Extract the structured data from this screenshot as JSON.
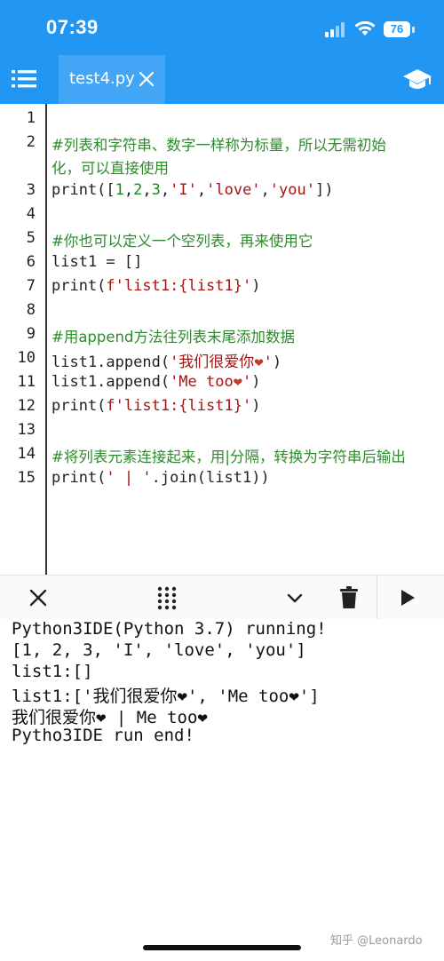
{
  "status_bar": {
    "time": "07:39",
    "battery": "76"
  },
  "tab": {
    "title": "test4.py"
  },
  "editor": {
    "line_numbers": [
      "1",
      "2",
      "3",
      "4",
      "5",
      "6",
      "7",
      "8",
      "9",
      "10",
      "11",
      "12",
      "13",
      "14",
      "15"
    ],
    "lines": {
      "l2a": "#列表和字符串、数字一样称为标量，所以无需初始",
      "l2b": "化，可以直接使用",
      "l3_print": "print([",
      "l3_1": "1",
      "l3_c1": ",",
      "l3_2": "2",
      "l3_c2": ",",
      "l3_3": "3",
      "l3_c3": ",",
      "l3_s1": "'I'",
      "l3_c4": ",",
      "l3_s2": "'love'",
      "l3_c5": ",",
      "l3_s3": "'you'",
      "l3_end": "])",
      "l5": "#你也可以定义一个空列表，再来使用它",
      "l6": "list1 = []",
      "l7_a": "print(",
      "l7_s": "f'list1:{list1}'",
      "l7_b": ")",
      "l9": "#用append方法往列表末尾添加数据",
      "l10_a": "list1.append(",
      "l10_s": "'我们很爱你",
      "l10_h": "❤",
      "l10_q": "'",
      "l10_b": ")",
      "l11_a": "list1.append(",
      "l11_s": "'Me too",
      "l11_h": "❤",
      "l11_q": "'",
      "l11_b": ")",
      "l12_a": "print(",
      "l12_s": "f'list1:{list1}'",
      "l12_b": ")",
      "l14": "#将列表元素连接起来，用|分隔，转换为字符串后输出",
      "l15_a": "print(",
      "l15_s": "' | '",
      "l15_b": ".join(list1))"
    }
  },
  "toolbar": {
    "close_icon": "close-icon",
    "keypad_icon": "keypad-icon",
    "chevron_icon": "chevron-down-icon",
    "delete_icon": "trash-icon",
    "run_icon": "play-icon"
  },
  "console": {
    "lines": [
      "Python3IDE(Python 3.7) running!",
      "[1, 2, 3, 'I', 'love', 'you']",
      "list1:[]",
      "list1:['我们很爱你❤', 'Me too❤']",
      "我们很爱你❤ | Me too❤",
      "Pytho3IDE run end!"
    ]
  },
  "watermark": "知乎 @Leonardo",
  "colors": {
    "header": "#2196f3",
    "tab_active": "#42a5f5",
    "comment": "#2e8b2e",
    "string": "#a31515"
  }
}
